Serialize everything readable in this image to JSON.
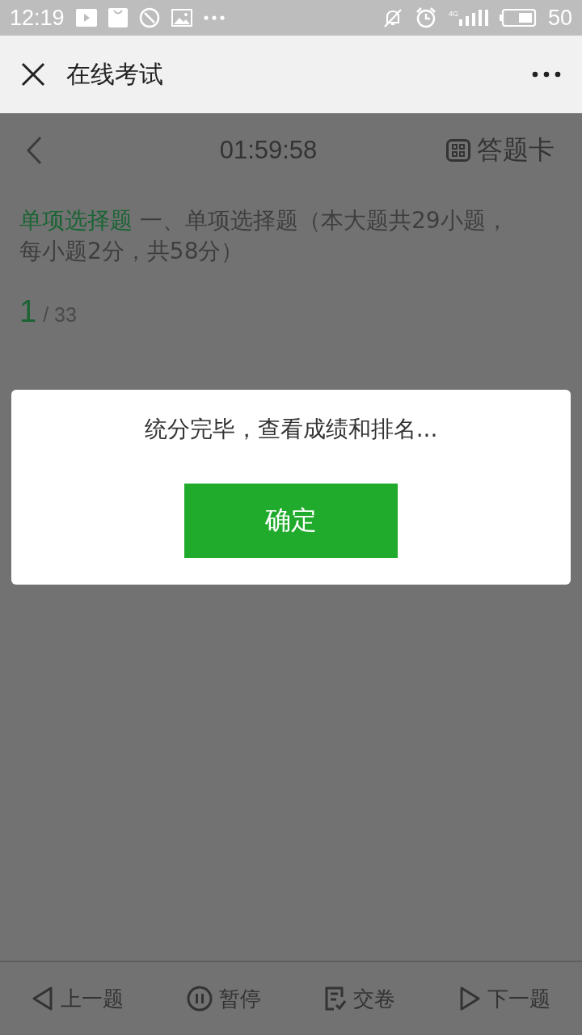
{
  "status_bar": {
    "time": "12:19",
    "network": "4G",
    "battery": "50"
  },
  "nav_bar": {
    "title": "在线考试"
  },
  "exam_header": {
    "timer": "01:59:58",
    "answer_card": "答题卡"
  },
  "question": {
    "type_label": "单项选择题",
    "description": "一、单项选择题（本大题共29小题，每小题2分，共58分）",
    "current": "1",
    "total": "/ 33"
  },
  "dialog": {
    "message": "统分完毕，查看成绩和排名...",
    "button": "确定"
  },
  "bottom_bar": [
    {
      "kind": "prev",
      "label": "上一题"
    },
    {
      "kind": "pause",
      "label": "暂停"
    },
    {
      "kind": "submit",
      "label": "交卷"
    },
    {
      "kind": "next",
      "label": "下一题"
    }
  ]
}
